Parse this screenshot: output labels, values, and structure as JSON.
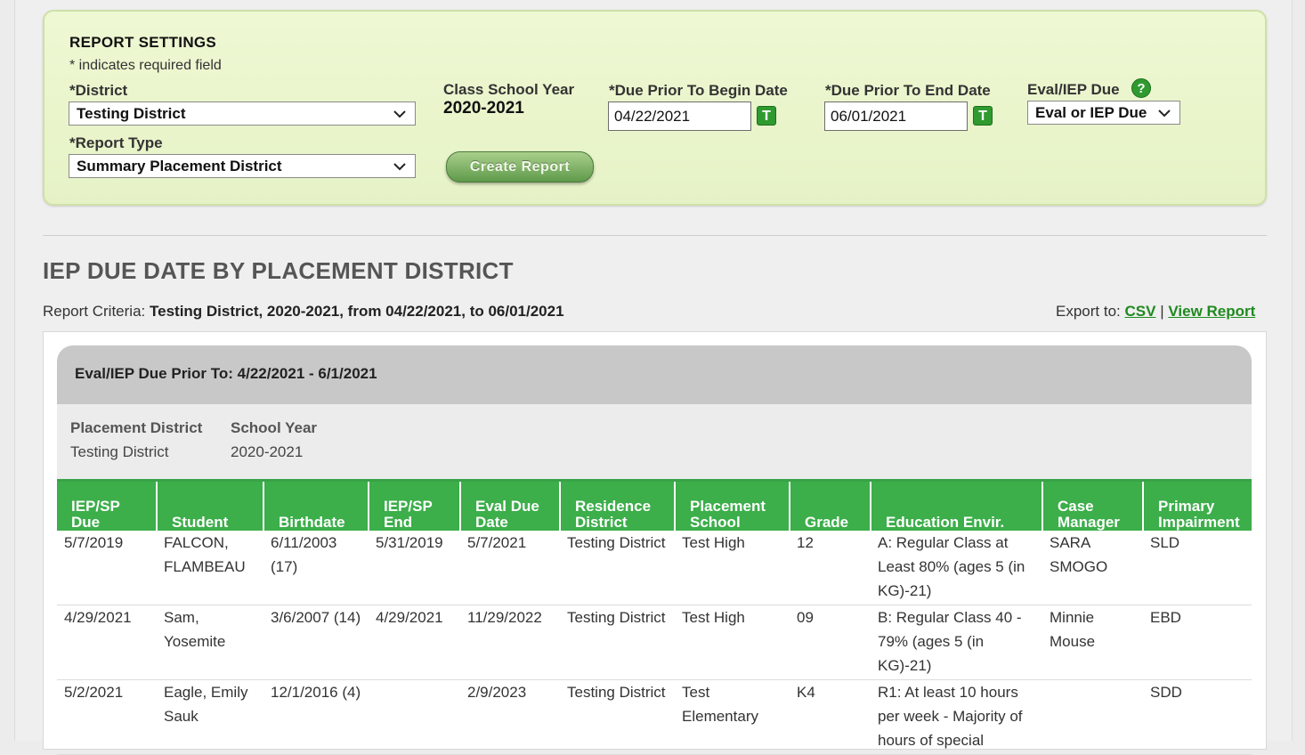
{
  "settings": {
    "title": "REPORT SETTINGS",
    "required_note": "* indicates required field",
    "district_label": "*District",
    "district_value": "Testing District",
    "report_type_label": "*Report Type",
    "report_type_value": "Summary Placement District",
    "class_year_label": "Class School Year",
    "class_year_value": "2020-2021",
    "begin_label": "*Due Prior To Begin Date",
    "begin_value": "04/22/2021",
    "end_label": "*Due Prior To End Date",
    "end_value": "06/01/2021",
    "eval_label": "Eval/IEP Due",
    "eval_value": "Eval or IEP Due",
    "t_glyph": "T",
    "help_glyph": "?",
    "create_label": "Create Report"
  },
  "report": {
    "title": "IEP DUE DATE BY PLACEMENT DISTRICT",
    "criteria_label": "Report Criteria:",
    "criteria_value": "Testing District, 2020-2021, from 04/22/2021, to 06/01/2021",
    "export_label": "Export to:",
    "export_csv": "CSV",
    "export_sep": "|",
    "export_view": "View Report",
    "group_header": "Eval/IEP Due Prior To: 4/22/2021 - 6/1/2021",
    "placement_district_label": "Placement District",
    "placement_district_value": "Testing District",
    "school_year_label": "School Year",
    "school_year_value": "2020-2021"
  },
  "table": {
    "headers": [
      "IEP/SP Due",
      "Student",
      "Birthdate",
      "IEP/SP End",
      "Eval Due Date",
      "Residence District",
      "Placement School",
      "Grade",
      "Education Envir.",
      "Case Manager",
      "Primary Impairment"
    ],
    "rows": [
      [
        "5/7/2019",
        "FALCON, FLAMBEAU",
        "6/11/2003 (17)",
        "5/31/2019",
        "5/7/2021",
        "Testing District",
        "Test High",
        "12",
        "A: Regular Class at Least 80% (ages 5 (in KG)-21)",
        "SARA SMOGO",
        "SLD"
      ],
      [
        "4/29/2021",
        "Sam, Yosemite",
        "3/6/2007 (14)",
        "4/29/2021",
        "11/29/2022",
        "Testing District",
        "Test High",
        "09",
        "B: Regular Class 40 - 79% (ages 5 (in KG)-21)",
        "Minnie Mouse",
        "EBD"
      ],
      [
        "5/2/2021",
        "Eagle, Emily Sauk",
        "12/1/2016 (4)",
        "",
        "2/9/2023",
        "Testing District",
        "Test Elementary",
        "K4",
        "R1: At least 10 hours per week - Majority of hours of special",
        "",
        "SDD"
      ]
    ]
  },
  "colors": {
    "accent_green": "#3cae4a",
    "link_green": "#1f8a1f",
    "panel_bg": "#eef8d3"
  }
}
